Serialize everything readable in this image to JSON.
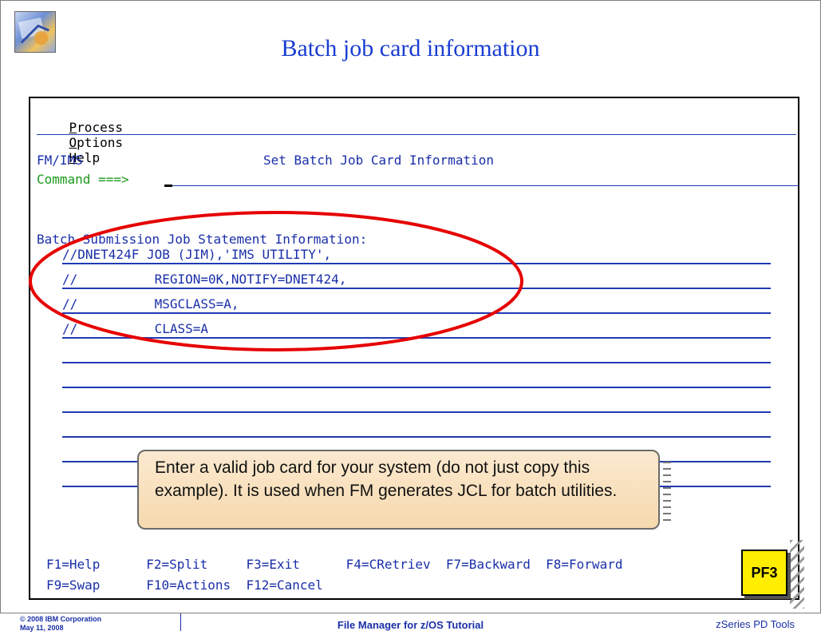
{
  "slide": {
    "title": "Batch job card information",
    "logo_icon": "ibm-tutorial-logo-icon"
  },
  "terminal": {
    "menu": [
      {
        "label": "Process",
        "mnemonic": "P",
        "rest": "rocess"
      },
      {
        "label": "Options",
        "mnemonic": "O",
        "rest": "ptions"
      },
      {
        "label": "Help",
        "mnemonic": "H",
        "rest": "elp"
      }
    ],
    "panel_id": "FM/IMS",
    "panel_title": "Set Batch Job Card Information",
    "command_label": "Command ===>",
    "command_value": "",
    "jcl_header": "Batch Submission Job Statement Information:",
    "jcl_lines": [
      "//DNET424F JOB (JIM),'IMS UTILITY',",
      "//          REGION=0K,NOTIFY=DNET424,",
      "//          MSGCLASS=A,",
      "//          CLASS=A",
      "",
      "",
      "",
      "",
      "",
      ""
    ],
    "fkeys_row1": "F1=Help      F2=Split     F3=Exit      F4=CRetriev  F7=Backward  F8=Forward",
    "fkeys_row2": "F9=Swap      F10=Actions  F12=Cancel"
  },
  "callout": {
    "text": "Enter a valid job card for your system (do not just copy this example).  It is used when FM generates JCL for batch utilities."
  },
  "pf3_label": "PF3",
  "footer": {
    "copyright": "© 2008 IBM Corporation",
    "date": "May 11, 2008",
    "center": "File Manager for z/OS Tutorial",
    "right": "zSeries PD Tools"
  },
  "colors": {
    "title": "#1a3dd1",
    "terminal_text": "#1a2fa8",
    "command_green": "#1a9a1a",
    "ellipse_red": "#e60000",
    "pf3_yellow": "#ffee00"
  }
}
